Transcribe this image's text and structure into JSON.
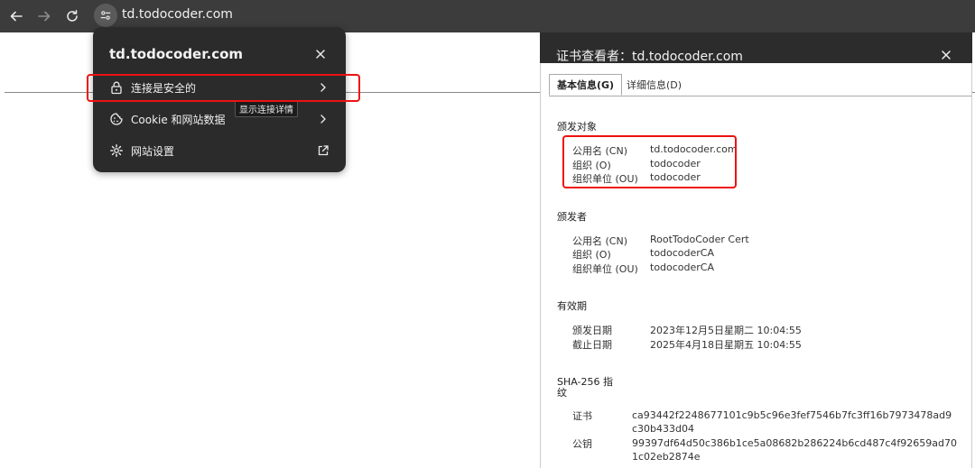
{
  "browser": {
    "url": "td.todocoder.com"
  },
  "site_popup": {
    "title": "td.todocoder.com",
    "items": [
      {
        "label": "连接是安全的",
        "icon": "lock-icon"
      },
      {
        "label": "Cookie 和网站数据",
        "icon": "cookie-icon"
      },
      {
        "label": "网站设置",
        "icon": "gear-icon"
      }
    ],
    "tooltip": "显示连接详情"
  },
  "cert_viewer": {
    "title": "证书查看者：td.todocoder.com",
    "tabs": [
      "基本信息(G)",
      "详细信息(D)"
    ],
    "issued_to": {
      "heading": "颁发对象",
      "rows": [
        {
          "label": "公用名 (CN)",
          "value": "td.todocoder.com"
        },
        {
          "label": "组织 (O)",
          "value": "todocoder"
        },
        {
          "label": "组织单位 (OU)",
          "value": "todocoder"
        }
      ]
    },
    "issued_by": {
      "heading": "颁发者",
      "rows": [
        {
          "label": "公用名 (CN)",
          "value": "RootTodoCoder Cert"
        },
        {
          "label": "组织 (O)",
          "value": "todocoderCA"
        },
        {
          "label": "组织单位 (OU)",
          "value": "todocoderCA"
        }
      ]
    },
    "validity": {
      "heading": "有效期",
      "rows": [
        {
          "label": "颁发日期",
          "value": "2023年12月5日星期二 10:04:55"
        },
        {
          "label": "截止日期",
          "value": "2025年4月18日星期五 10:04:55"
        }
      ]
    },
    "fingerprint": {
      "heading_line1": "SHA-256 指",
      "heading_line2": "纹",
      "rows": [
        {
          "label": "证书",
          "value": "ca93442f2248677101c9b5c96e3fef7546b7fc3ff16b7973478ad9c30b433d04"
        },
        {
          "label": "公钥",
          "value": "99397df64d50c386b1ce5a08682b286224b6cd487c4f92659ad701c02eb2874e"
        }
      ]
    }
  },
  "colors": {
    "highlight": "#ee1111"
  }
}
